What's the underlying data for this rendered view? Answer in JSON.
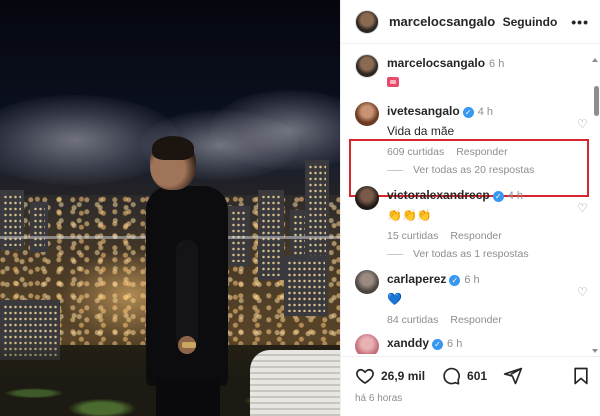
{
  "header": {
    "username": "marcelocsangalo",
    "follow_label": "Seguindo",
    "more_label": "•••"
  },
  "comments": [
    {
      "username": "marcelocsangalo",
      "time": "6 h",
      "text": "",
      "verified": false,
      "emoji": "flag"
    },
    {
      "username": "ivetesangalo",
      "time": "4 h",
      "text": "Vida da mãe",
      "verified": true,
      "likes": "609 curtidas",
      "reply_label": "Responder",
      "highlighted": true
    },
    {
      "replies_label": "Ver todas as 20 respostas"
    },
    {
      "username": "victoralexandrecp",
      "time": "4 h",
      "text": "👏👏👏",
      "verified": true,
      "likes": "15 curtidas",
      "reply_label": "Responder"
    },
    {
      "replies_label": "Ver todas as 1 respostas"
    },
    {
      "username": "carlaperez",
      "time": "6 h",
      "text": "💙",
      "verified": true,
      "likes": "84 curtidas",
      "reply_label": "Responder"
    },
    {
      "username": "xanddy",
      "time": "6 h",
      "text": "",
      "verified": true
    }
  ],
  "actions": {
    "like_count": "26,9 mil",
    "comment_count": "601",
    "posted_ago": "há 6 horas"
  },
  "colors": {
    "highlight_border": "#d9262c",
    "verified": "#3897f0",
    "muted_text": "#8e8e8e"
  }
}
